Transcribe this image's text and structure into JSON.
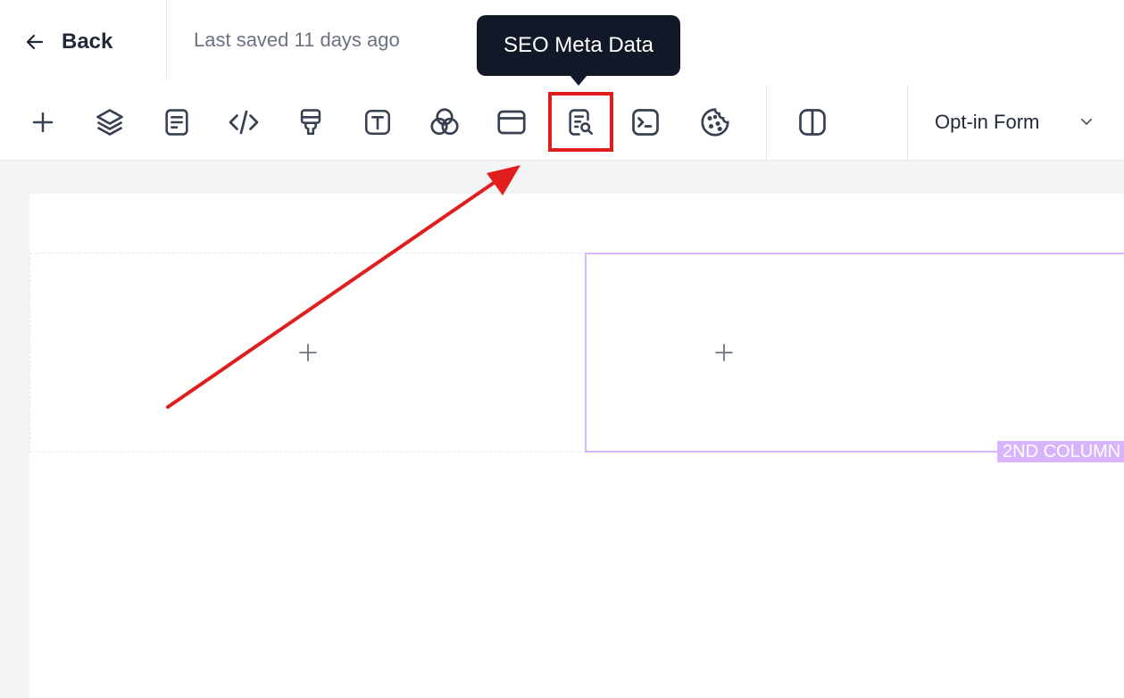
{
  "header": {
    "back_label": "Back",
    "last_saved": "Last saved 11 days ago"
  },
  "toolbar": {
    "items": [
      {
        "name": "add-element",
        "icon": "plus-icon"
      },
      {
        "name": "layers",
        "icon": "layers-icon"
      },
      {
        "name": "page-settings",
        "icon": "document-icon"
      },
      {
        "name": "custom-code",
        "icon": "code-icon"
      },
      {
        "name": "styles",
        "icon": "paint-brush-icon"
      },
      {
        "name": "typography",
        "icon": "text-icon"
      },
      {
        "name": "colors",
        "icon": "color-circles-icon"
      },
      {
        "name": "layout",
        "icon": "window-icon"
      },
      {
        "name": "seo-meta-data",
        "icon": "document-search-icon"
      },
      {
        "name": "scripts",
        "icon": "terminal-icon"
      },
      {
        "name": "cookies",
        "icon": "cookie-icon"
      },
      {
        "name": "preview-split",
        "icon": "split-view-icon"
      }
    ],
    "tooltip": "SEO Meta Data",
    "dropdown_selected": "Opt-in Form"
  },
  "canvas": {
    "column_badge": "2ND COLUMN"
  },
  "colors": {
    "highlight": "#e11d1d",
    "column_accent": "#d8b4fe",
    "tooltip_bg": "#111827"
  }
}
